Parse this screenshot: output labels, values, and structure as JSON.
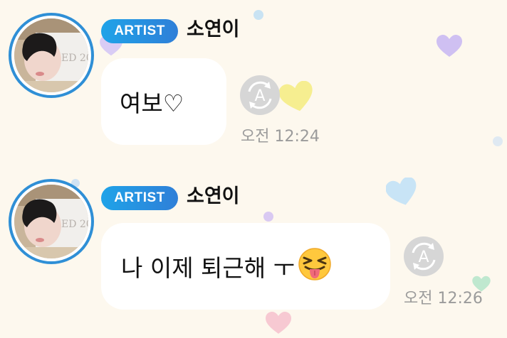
{
  "messages": [
    {
      "badge": "ARTIST",
      "sender": "소연이",
      "text": "여보♡",
      "time": "오전 12:24",
      "emoji": null
    },
    {
      "badge": "ARTIST",
      "sender": "소연이",
      "text": "나 이제 퇴근해 ㅜ",
      "time": "오전 12:26",
      "emoji": "squinting-face-with-tongue"
    }
  ],
  "icons": {
    "auto_translate": "auto-translate-icon",
    "avatar": "artist-avatar"
  },
  "colors": {
    "background": "#fdf8ee",
    "badge": "#2f8fd6",
    "bubble": "#ffffff",
    "time": "#9b9b9b"
  }
}
